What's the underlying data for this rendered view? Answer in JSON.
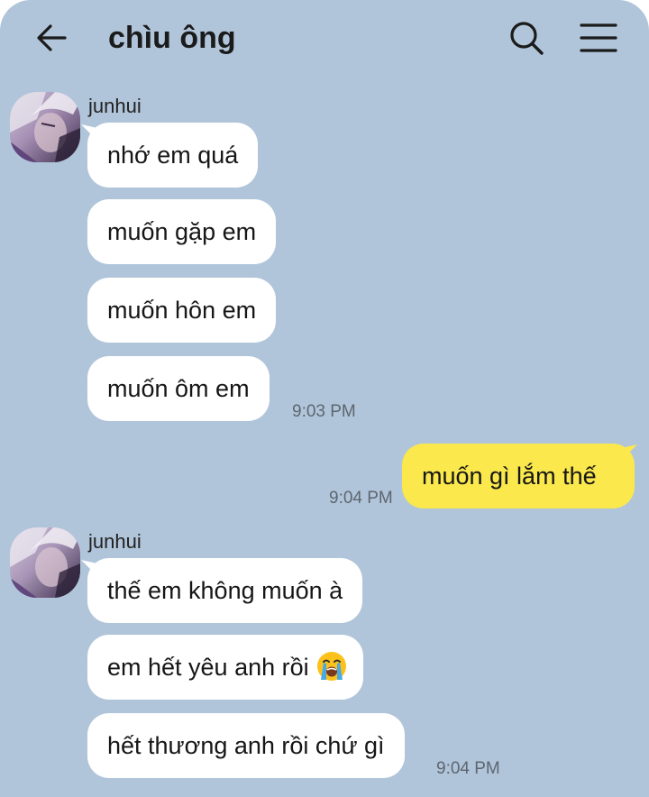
{
  "header": {
    "title": "chìu ông",
    "back_icon": "arrow-left-icon",
    "search_icon": "search-icon",
    "menu_icon": "hamburger-menu-icon"
  },
  "colors": {
    "background": "#b1c5da",
    "incoming_bubble": "#ffffff",
    "outgoing_bubble": "#fae84c",
    "timestamp": "#5d6670"
  },
  "messages": {
    "group1": {
      "sender": "junhui",
      "bubbles": [
        "nhớ em quá",
        "muốn gặp em",
        "muốn hôn em",
        "muốn ôm em"
      ],
      "time": "9:03 PM"
    },
    "outgoing": {
      "text": "muốn gì lắm thế",
      "time": "9:04 PM"
    },
    "group2": {
      "sender": "junhui",
      "bubbles": [
        "thế em không muốn à",
        "em hết yêu anh rồi",
        "hết thương anh rồi chứ gì"
      ],
      "emoji": "loudly-crying-face-emoji",
      "time": "9:04 PM"
    }
  }
}
